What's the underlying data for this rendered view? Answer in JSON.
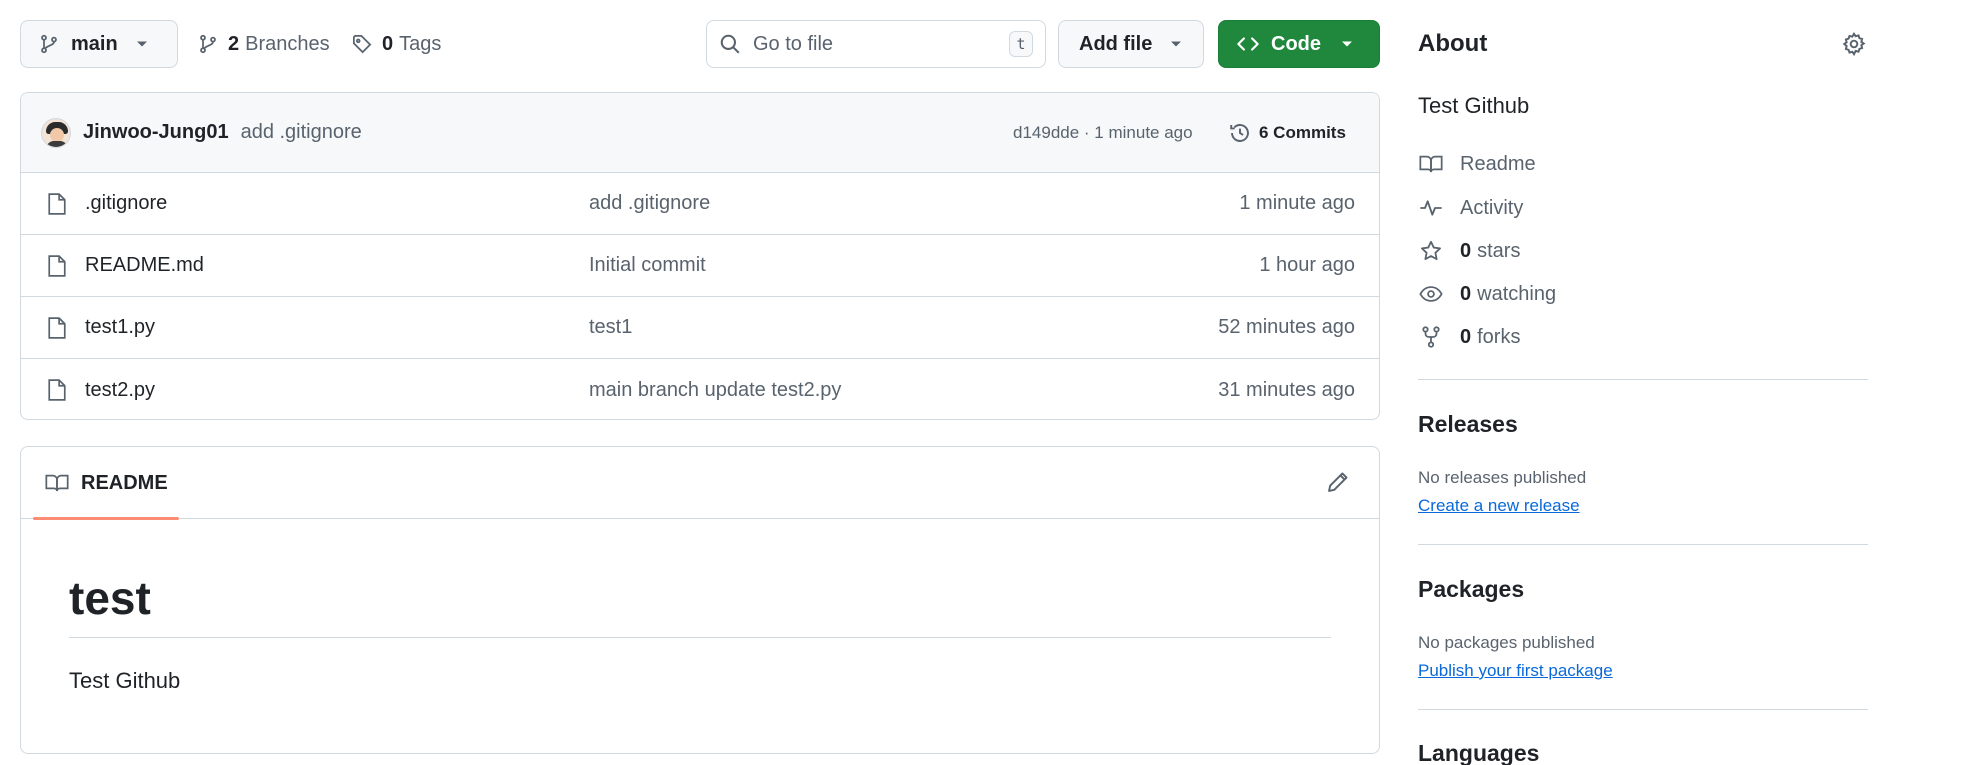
{
  "toolbar": {
    "branch": "main",
    "branches_count": "2",
    "branches_label": "Branches",
    "tags_count": "0",
    "tags_label": "Tags",
    "search_placeholder": "Go to file",
    "search_shortcut": "t",
    "add_file_label": "Add file",
    "code_label": "Code",
    "code_color": "#1f883d"
  },
  "latest_commit": {
    "author": "Jinwoo-Jung01",
    "message": "add .gitignore",
    "hash_time": "d149dde · 1 minute ago",
    "commits_label": "6 Commits"
  },
  "files": [
    {
      "name": ".gitignore",
      "commit": "add .gitignore",
      "date": "1 minute ago",
      "icon": "file-icon"
    },
    {
      "name": "README.md",
      "commit": "Initial commit",
      "date": "1 hour ago",
      "icon": "file-icon"
    },
    {
      "name": "test1.py",
      "commit": "test1",
      "date": "52 minutes ago",
      "icon": "file-icon"
    },
    {
      "name": "test2.py",
      "commit": "main branch update test2.py",
      "date": "31 minutes ago",
      "icon": "file-icon"
    }
  ],
  "readme": {
    "tab_label": "README",
    "tab_accent": "#fd8c73",
    "heading": "test",
    "body": "Test Github"
  },
  "about": {
    "title": "About",
    "description": "Test Github",
    "items": [
      {
        "icon": "book-icon",
        "count": "",
        "label": "Readme"
      },
      {
        "icon": "pulse-icon",
        "count": "",
        "label": "Activity"
      },
      {
        "icon": "star-icon",
        "count": "0",
        "label": "stars"
      },
      {
        "icon": "eye-icon",
        "count": "0",
        "label": "watching"
      },
      {
        "icon": "fork-icon",
        "count": "0",
        "label": "forks"
      }
    ]
  },
  "releases": {
    "title": "Releases",
    "note": "No releases published",
    "link": "Create a new release"
  },
  "packages": {
    "title": "Packages",
    "note": "No packages published",
    "link": "Publish your first package"
  },
  "languages": {
    "title": "Languages"
  },
  "colors": {
    "link": "#0969da",
    "muted": "#59636e",
    "border": "#d1d9e0"
  }
}
